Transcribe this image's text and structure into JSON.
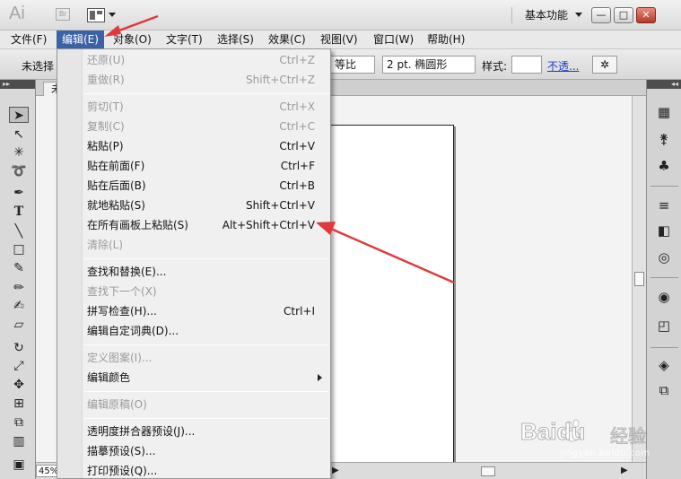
{
  "app": {
    "logo": "Ai",
    "bridge_logo": "Br",
    "workspace": "基本功能",
    "win_minimize": "—",
    "win_restore": "□",
    "win_close": "✕"
  },
  "menubar": [
    {
      "label": "文件(F)"
    },
    {
      "label": "编辑(E)"
    },
    {
      "label": "对象(O)"
    },
    {
      "label": "文字(T)"
    },
    {
      "label": "选择(S)"
    },
    {
      "label": "效果(C)"
    },
    {
      "label": "视图(V)"
    },
    {
      "label": "窗口(W)"
    },
    {
      "label": "帮助(H)"
    }
  ],
  "controlbar": {
    "no_selection": "未选择",
    "profile": "等比",
    "brush": "2 pt. 椭圆形",
    "style_label": "样式:",
    "opacity_link": "不透..."
  },
  "document": {
    "tab_label": "未",
    "zoom": "45%"
  },
  "edit_menu": {
    "groups": [
      [
        {
          "label": "还原(U)",
          "shortcut": "Ctrl+Z",
          "enabled": false
        },
        {
          "label": "重做(R)",
          "shortcut": "Shift+Ctrl+Z",
          "enabled": false
        }
      ],
      [
        {
          "label": "剪切(T)",
          "shortcut": "Ctrl+X",
          "enabled": false
        },
        {
          "label": "复制(C)",
          "shortcut": "Ctrl+C",
          "enabled": false
        },
        {
          "label": "粘贴(P)",
          "shortcut": "Ctrl+V",
          "enabled": true
        },
        {
          "label": "贴在前面(F)",
          "shortcut": "Ctrl+F",
          "enabled": true
        },
        {
          "label": "贴在后面(B)",
          "shortcut": "Ctrl+B",
          "enabled": true
        },
        {
          "label": "就地粘贴(S)",
          "shortcut": "Shift+Ctrl+V",
          "enabled": true
        },
        {
          "label": "在所有画板上粘贴(S)",
          "shortcut": "Alt+Shift+Ctrl+V",
          "enabled": true
        },
        {
          "label": "清除(L)",
          "shortcut": "",
          "enabled": false
        }
      ],
      [
        {
          "label": "查找和替换(E)...",
          "shortcut": "",
          "enabled": true
        },
        {
          "label": "查找下一个(X)",
          "shortcut": "",
          "enabled": false
        },
        {
          "label": "拼写检查(H)...",
          "shortcut": "Ctrl+I",
          "enabled": true
        },
        {
          "label": "编辑自定词典(D)...",
          "shortcut": "",
          "enabled": true
        }
      ],
      [
        {
          "label": "定义图案(I)...",
          "shortcut": "",
          "enabled": false
        },
        {
          "label": "编辑颜色",
          "shortcut": "",
          "enabled": true,
          "submenu": true
        }
      ],
      [
        {
          "label": "编辑原稿(O)",
          "shortcut": "",
          "enabled": false
        }
      ],
      [
        {
          "label": "透明度拼合器预设(J)...",
          "shortcut": "",
          "enabled": true
        },
        {
          "label": "描摹预设(S)...",
          "shortcut": "",
          "enabled": true
        },
        {
          "label": "打印预设(Q)...",
          "shortcut": "",
          "enabled": true
        }
      ]
    ]
  },
  "watermark": {
    "brand": "Baidu",
    "brand_cn": "经验",
    "url": "jingyan.baidu.com"
  },
  "colors": {
    "menu_highlight": "#3b62a7",
    "annotation_arrow": "#e0393b"
  }
}
